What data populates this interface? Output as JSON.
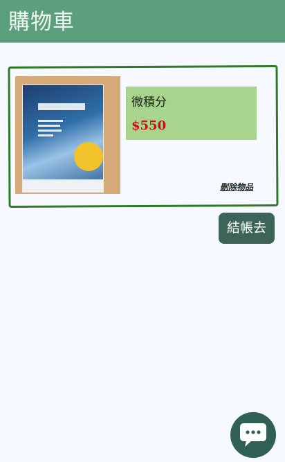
{
  "header": {
    "title": "購物車"
  },
  "cart": {
    "items": [
      {
        "name": "微積分",
        "price": "$550",
        "remove_label": "刪除物品"
      }
    ]
  },
  "checkout": {
    "label": "結帳去"
  },
  "chat": {
    "icon": "chat-bubble-icon"
  },
  "colors": {
    "header_bg": "#5c9f7e",
    "card_border": "#2f7a28",
    "info_bg": "#a7d58e",
    "price": "#c21212",
    "button_bg": "#3d6458",
    "chat_bg": "#2f5f55"
  }
}
